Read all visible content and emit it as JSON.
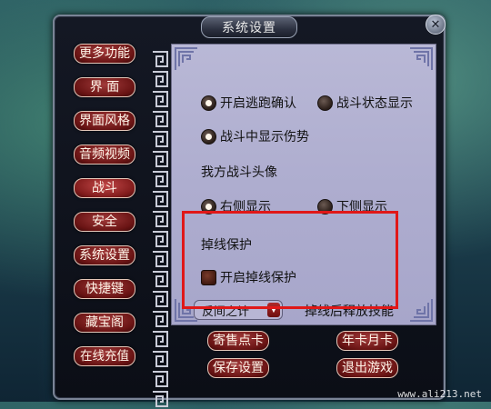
{
  "window": {
    "title": "系统设置",
    "close_glyph": "✕"
  },
  "sidebar": {
    "items": [
      {
        "label": "更多功能"
      },
      {
        "label": "界  面"
      },
      {
        "label": "界面风格"
      },
      {
        "label": "音频视频"
      },
      {
        "label": "战斗",
        "active": true
      },
      {
        "label": "安全"
      },
      {
        "label": "系统设置"
      },
      {
        "label": "快捷键"
      },
      {
        "label": "藏宝阁"
      },
      {
        "label": "在线充值"
      }
    ]
  },
  "battle": {
    "options": [
      {
        "label": "开启逃跑确认",
        "checked": true
      },
      {
        "label": "战斗状态显示",
        "checked": false
      },
      {
        "label": "战斗中显示伤势",
        "checked": true
      }
    ],
    "avatar_section_label": "我方战斗头像",
    "avatar_options": [
      {
        "label": "右侧显示",
        "checked": true
      },
      {
        "label": "下侧显示",
        "checked": false
      }
    ],
    "disconnect": {
      "section_label": "掉线保护",
      "enable_label": "开启掉线保护",
      "enable_checked": false,
      "skill_select_value": "反间之计",
      "skill_label": "掉线后释放技能"
    }
  },
  "footer": {
    "buttons": [
      {
        "label": "寄售点卡"
      },
      {
        "label": "年卡月卡"
      },
      {
        "label": "保存设置"
      },
      {
        "label": "退出游戏"
      }
    ]
  },
  "watermark": "www.ali213.net",
  "colors": {
    "highlight_box": "#e01818",
    "button_red": "#6a1414",
    "panel_bg": "#b9b8d6"
  }
}
